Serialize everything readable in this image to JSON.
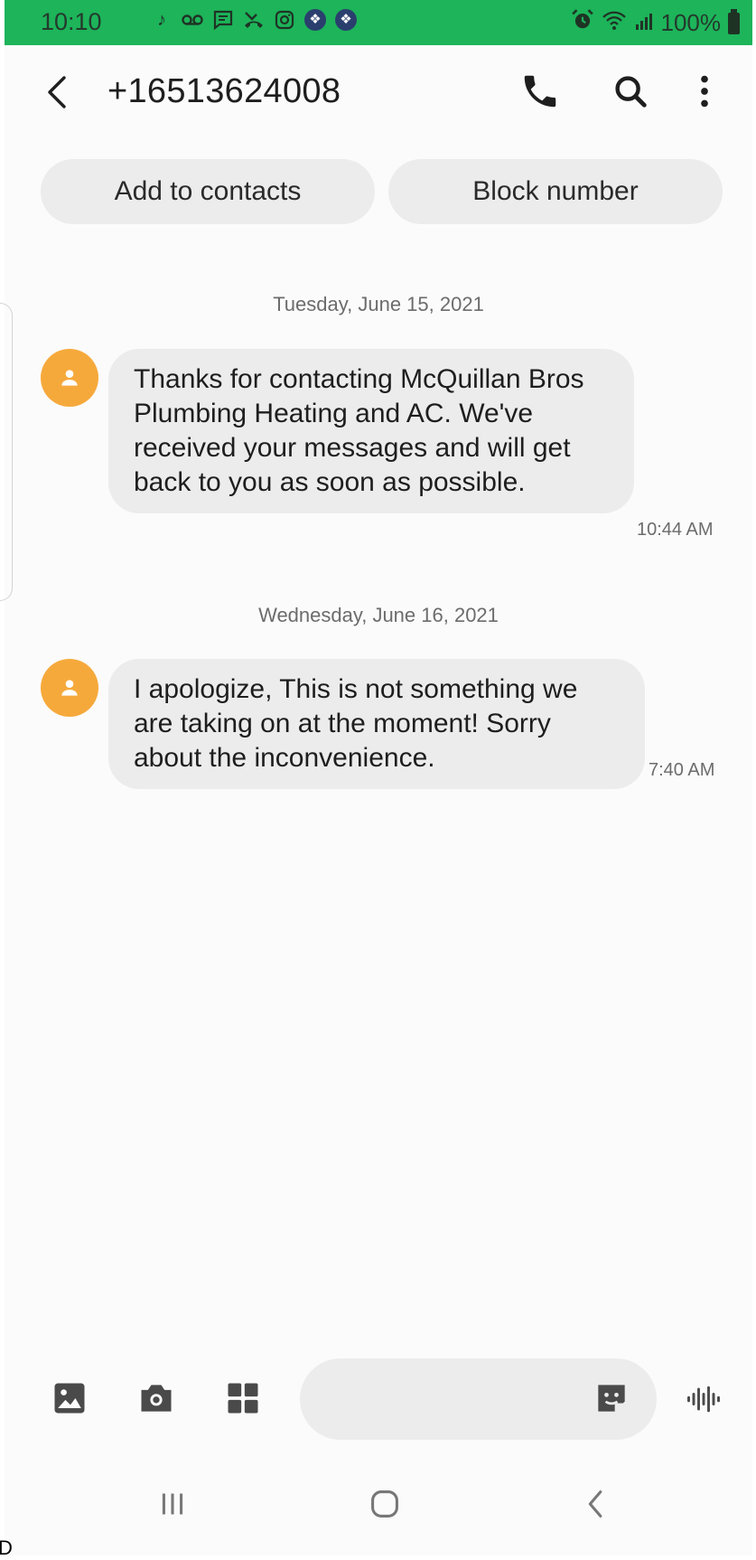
{
  "status_bar": {
    "time": "10:10",
    "battery_percent": "100%",
    "notification_icons": [
      "tiktok-icon",
      "voicemail-icon",
      "message-icon",
      "missed-call-icon",
      "instagram-icon",
      "app-icon",
      "app-icon"
    ],
    "system_icons": [
      "alarm-icon",
      "wifi-icon",
      "signal-icon",
      "battery-icon"
    ],
    "background_color": "#1db45a"
  },
  "header": {
    "title": "+16513624008",
    "actions": [
      "back-icon",
      "phone-icon",
      "search-icon",
      "more-vertical-icon"
    ]
  },
  "quick_actions": {
    "add_to_contacts": "Add to contacts",
    "block_number": "Block number"
  },
  "conversation": {
    "groups": [
      {
        "date": "Tuesday, June 15, 2021",
        "message": {
          "text": "Thanks for contacting McQuillan Bros Plumbing Heating and AC. We've received your messages and will get back to you as soon as possible.",
          "time": "10:44 AM"
        }
      },
      {
        "date": "Wednesday, June 16, 2021",
        "message": {
          "text": "I apologize, This is not something we are taking on at the moment! Sorry about the inconvenience.",
          "time": "7:40 AM"
        }
      }
    ],
    "avatar_color": "#f6a93b"
  },
  "composer": {
    "input_value": "",
    "icons": [
      "gallery-icon",
      "camera-icon",
      "apps-icon",
      "sticker-icon",
      "voice-icon"
    ]
  },
  "nav_bar": {
    "icons": [
      "recents-icon",
      "home-icon",
      "back-icon"
    ]
  },
  "corner_text": "D"
}
